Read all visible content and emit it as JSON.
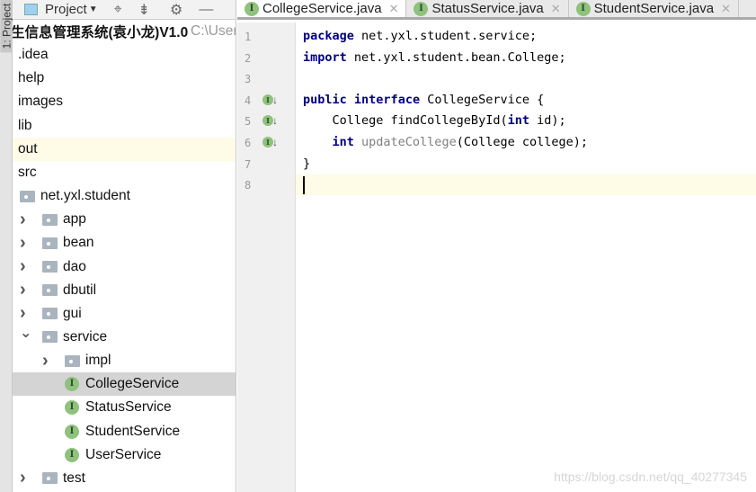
{
  "sidebar_stripe": {
    "label": "1: Project"
  },
  "project_toolbar": {
    "title": "Project",
    "icons": [
      "locate-icon",
      "collapse-icon",
      "gear-icon",
      "minimize-icon"
    ]
  },
  "tree": [
    {
      "label": "生信息管理系统(袁小龙)V1.0",
      "path": "C:\\User",
      "level": 0,
      "type": "root"
    },
    {
      "label": ".idea",
      "level": 0,
      "type": "plain"
    },
    {
      "label": "help",
      "level": 0,
      "type": "plain"
    },
    {
      "label": "images",
      "level": 0,
      "type": "plain"
    },
    {
      "label": "lib",
      "level": 0,
      "type": "plain"
    },
    {
      "label": "out",
      "level": 0,
      "type": "plain",
      "highlight": true
    },
    {
      "label": "src",
      "level": 0,
      "type": "plain"
    },
    {
      "label": "net.yxl.student",
      "level": 1,
      "type": "package"
    },
    {
      "label": "app",
      "level": 2,
      "type": "package",
      "collapsed": true
    },
    {
      "label": "bean",
      "level": 2,
      "type": "package",
      "collapsed": true
    },
    {
      "label": "dao",
      "level": 2,
      "type": "package",
      "collapsed": true
    },
    {
      "label": "dbutil",
      "level": 2,
      "type": "package",
      "collapsed": true
    },
    {
      "label": "gui",
      "level": 2,
      "type": "package",
      "collapsed": true
    },
    {
      "label": "service",
      "level": 2,
      "type": "package",
      "expanded": true
    },
    {
      "label": "impl",
      "level": 3,
      "type": "package",
      "collapsed": true
    },
    {
      "label": "CollegeService",
      "level": 3,
      "type": "interface",
      "selected": true
    },
    {
      "label": "StatusService",
      "level": 3,
      "type": "interface"
    },
    {
      "label": "StudentService",
      "level": 3,
      "type": "interface"
    },
    {
      "label": "UserService",
      "level": 3,
      "type": "interface"
    },
    {
      "label": "test",
      "level": 2,
      "type": "package",
      "collapsed": true
    }
  ],
  "tabs": [
    {
      "label": "CollegeService.java",
      "active": true
    },
    {
      "label": "StatusService.java"
    },
    {
      "label": "StudentService.java"
    }
  ],
  "editor": {
    "current_line": 8,
    "lines": [
      {
        "n": "1",
        "tokens": [
          [
            "kw",
            "package"
          ],
          [
            "",
            "net.yxl.student.service;"
          ]
        ]
      },
      {
        "n": "2",
        "tokens": [
          [
            "kw",
            "import"
          ],
          [
            "",
            "net.yxl.student.bean.College;"
          ]
        ]
      },
      {
        "n": "3",
        "tokens": []
      },
      {
        "n": "4",
        "gutter_icon": true,
        "tokens": [
          [
            "kw",
            "public"
          ],
          [
            "kw",
            "interface"
          ],
          [
            "",
            "CollegeService {"
          ]
        ]
      },
      {
        "n": "5",
        "gutter_icon": true,
        "tokens": [
          [
            "",
            "    College findCollegeById("
          ],
          [
            "kw",
            "int"
          ],
          [
            "",
            " id);"
          ]
        ]
      },
      {
        "n": "6",
        "gutter_icon": true,
        "tokens": [
          [
            "",
            "    "
          ],
          [
            "kw",
            "int"
          ],
          [
            "un",
            " updateCollege"
          ],
          [
            "",
            "(College college);"
          ]
        ]
      },
      {
        "n": "7",
        "tokens": [
          [
            "",
            "}"
          ]
        ]
      },
      {
        "n": "8",
        "tokens": []
      }
    ]
  },
  "watermark": "https://blog.csdn.net/qq_40277345",
  "colors": {
    "keyword": "#000080",
    "selection": "#d4d4d4",
    "current_line": "#fefbe6",
    "interface_icon": "#8fc27d"
  }
}
